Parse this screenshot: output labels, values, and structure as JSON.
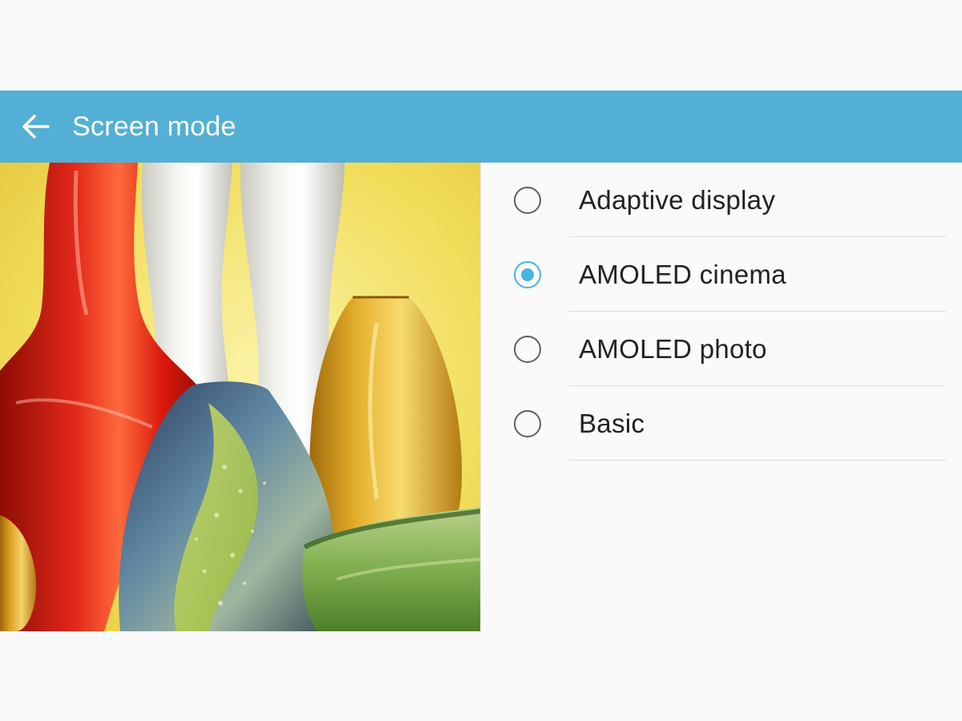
{
  "app_bar": {
    "title": "Screen mode",
    "back_icon": "arrow-left-icon",
    "color": "#53afd5"
  },
  "preview": {
    "description_icon": "glass-vases-preview-image"
  },
  "options": [
    {
      "label": "Adaptive display",
      "selected": false
    },
    {
      "label": "AMOLED cinema",
      "selected": true
    },
    {
      "label": "AMOLED photo",
      "selected": false
    },
    {
      "label": "Basic",
      "selected": false
    }
  ],
  "accent_color": "#46b3e0"
}
